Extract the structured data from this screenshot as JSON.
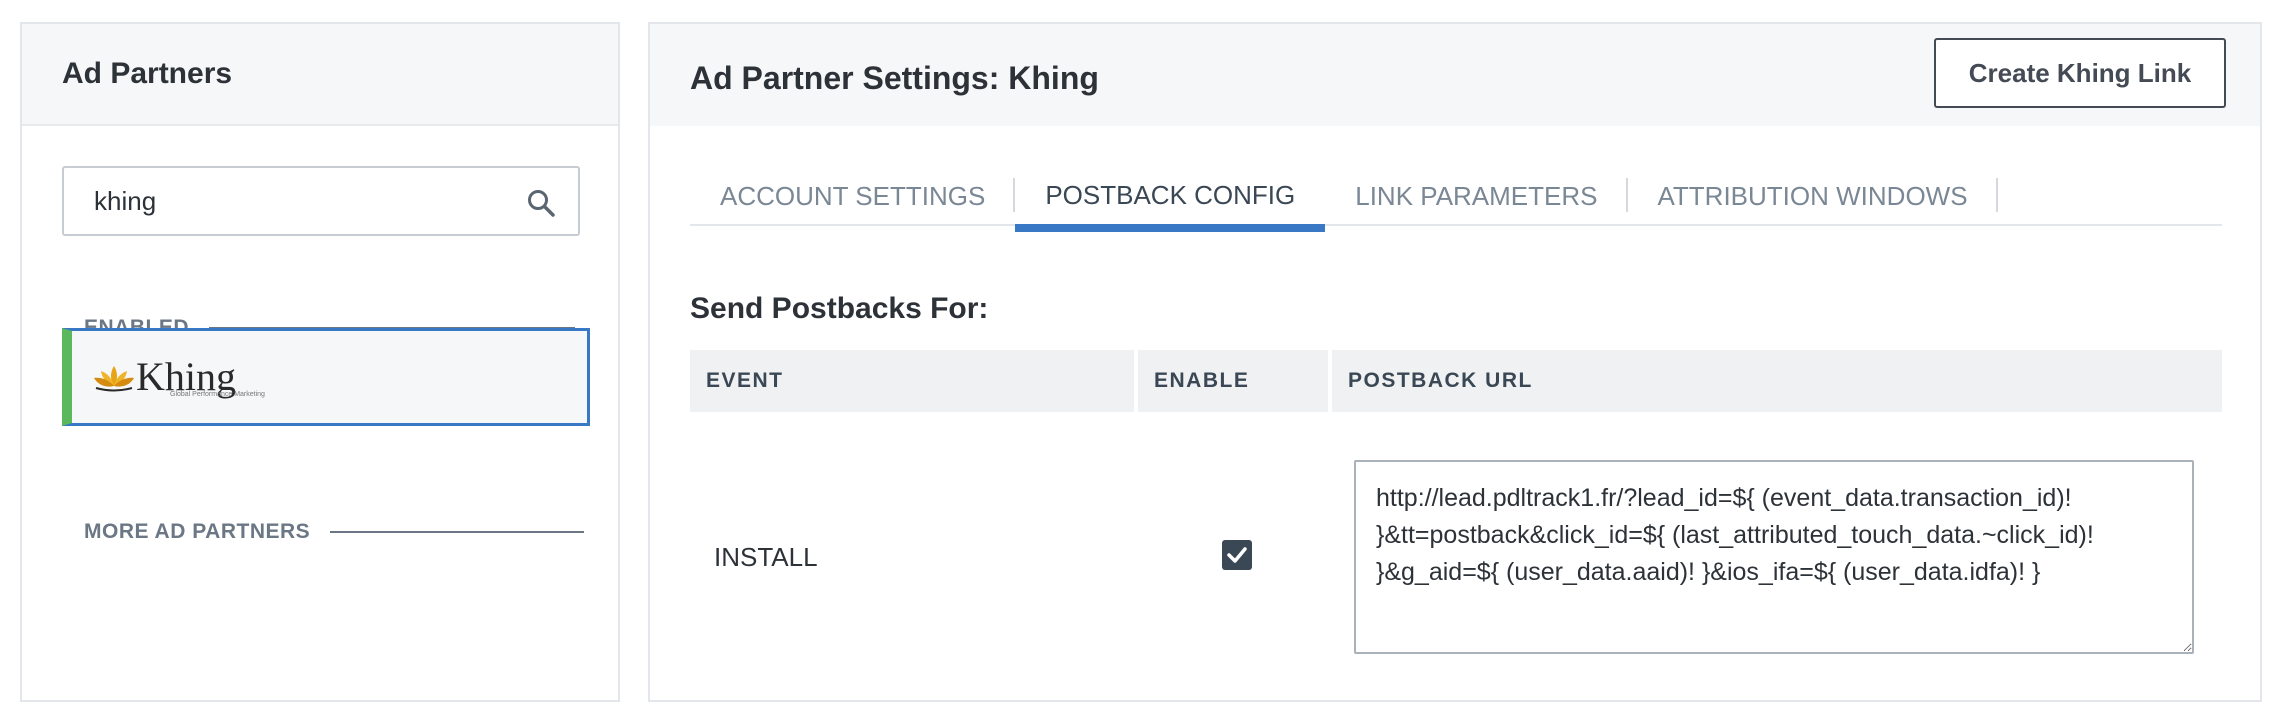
{
  "sidebar": {
    "title": "Ad Partners",
    "search": {
      "value": "khing"
    },
    "enabled_label": "ENABLED",
    "enabled_partner": {
      "name": "Khing",
      "tagline": "Global Performance Marketing"
    },
    "more_label": "MORE AD PARTNERS"
  },
  "main": {
    "title": "Ad Partner Settings: Khing",
    "create_button": "Create Khing Link",
    "tabs": [
      {
        "label": "ACCOUNT SETTINGS",
        "active": false
      },
      {
        "label": "POSTBACK CONFIG",
        "active": true
      },
      {
        "label": "LINK PARAMETERS",
        "active": false
      },
      {
        "label": "ATTRIBUTION WINDOWS",
        "active": false
      }
    ],
    "section_title": "Send Postbacks For:",
    "table": {
      "columns": [
        "EVENT",
        "ENABLE",
        "POSTBACK URL"
      ],
      "rows": [
        {
          "event": "INSTALL",
          "enabled": true,
          "postback_url": "http://lead.pdltrack1.fr/?lead_id=${ (event_data.transaction_id)! }&tt=postback&click_id=${ (last_attributed_touch_data.~click_id)! }&g_aid=${ (user_data.aaid)! }&ios_ifa=${ (user_data.idfa)! }"
        }
      ]
    }
  },
  "colors": {
    "accent": "#3878c5",
    "enabled_bar": "#5cb85c",
    "header_bg": "#f6f7f9"
  }
}
